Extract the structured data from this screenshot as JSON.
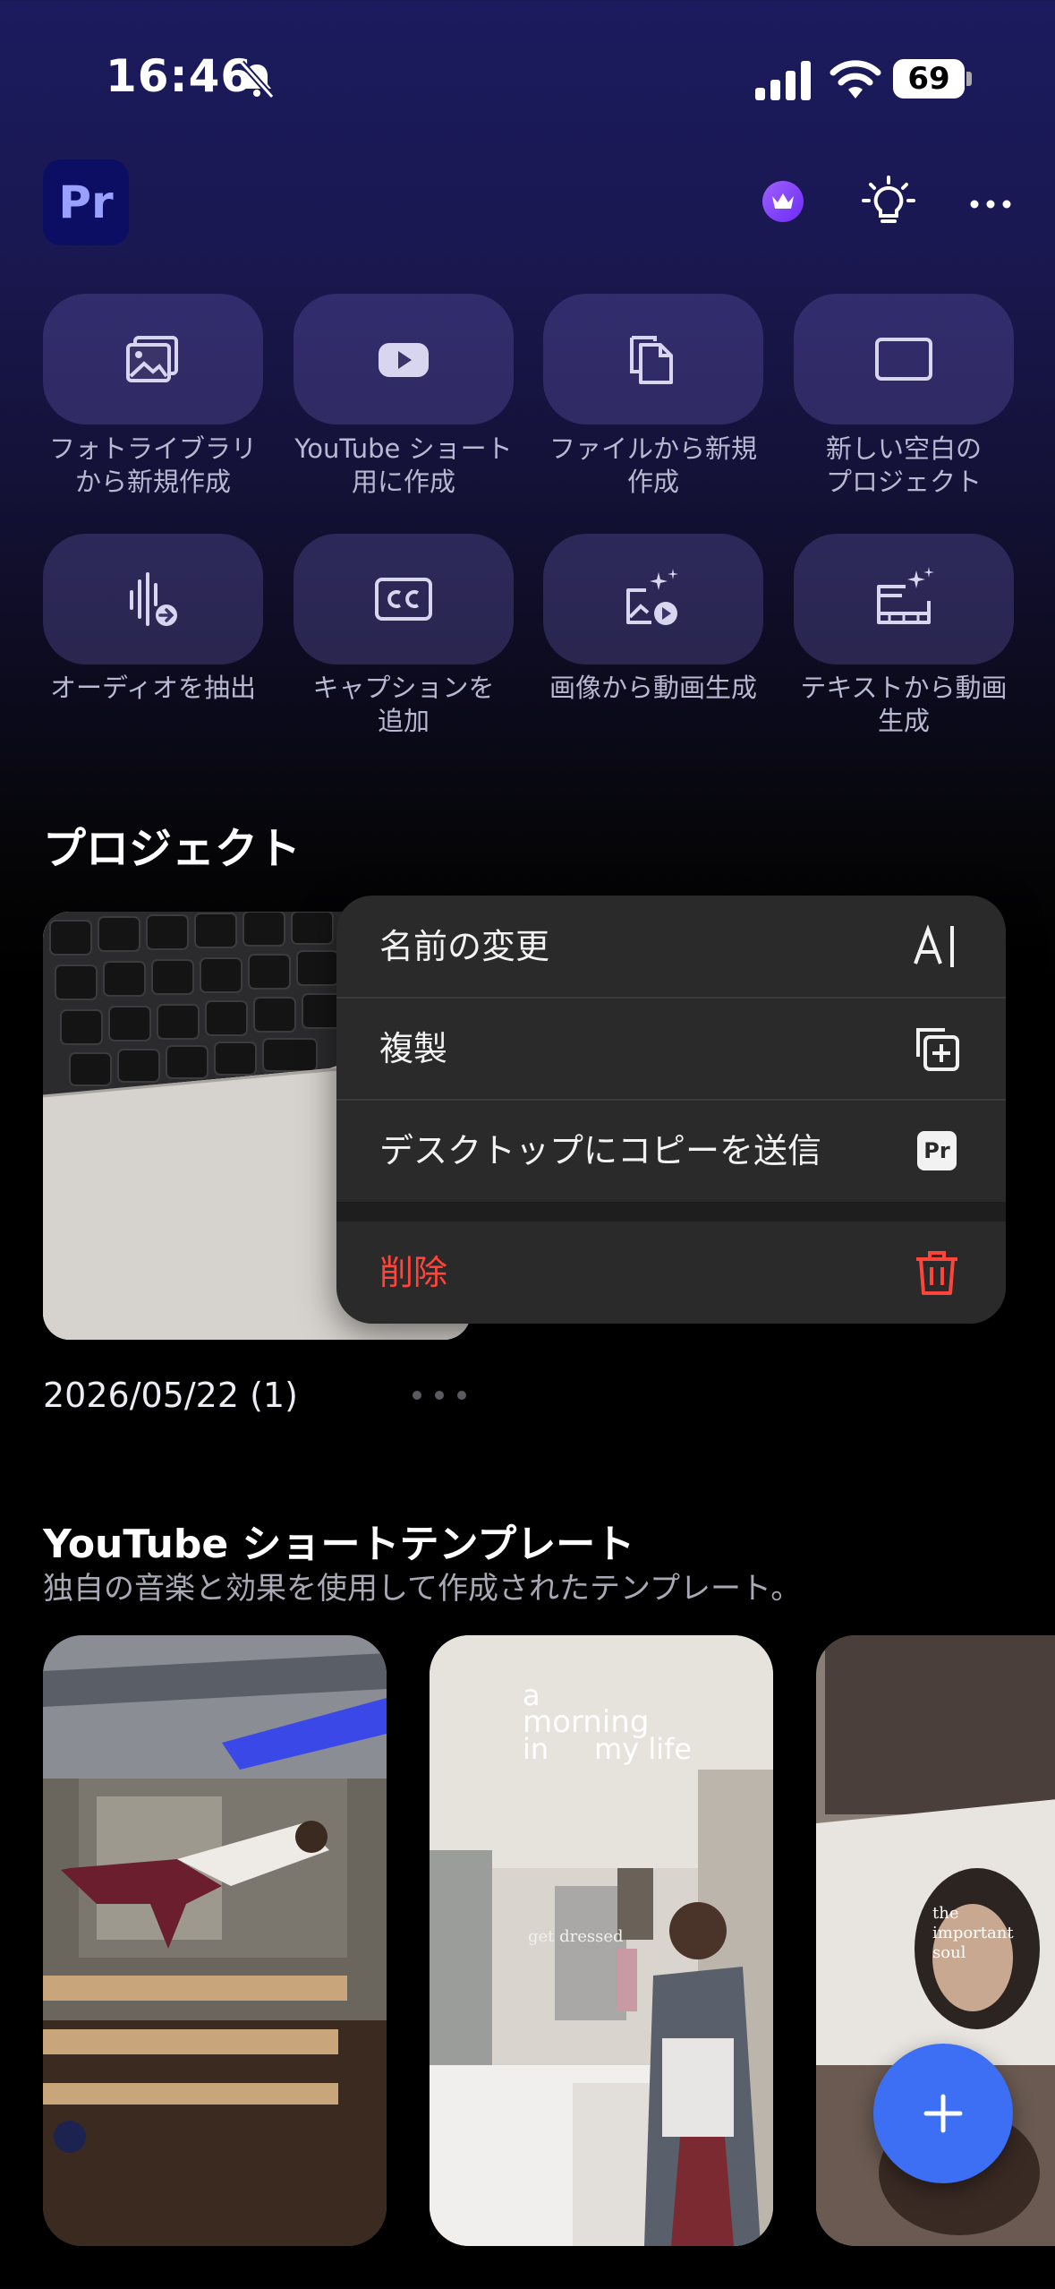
{
  "status_bar": {
    "time": "16:46",
    "battery": "69"
  },
  "header": {
    "logo_text": "Pr"
  },
  "actions": [
    {
      "label": "フォトライブラリ\nから新規作成",
      "icon": "photo-library-icon"
    },
    {
      "label": "YouTube ショート\n用に作成",
      "icon": "youtube-icon"
    },
    {
      "label": "ファイルから新規\n作成",
      "icon": "files-icon"
    },
    {
      "label": "新しい空白の\nプロジェクト",
      "icon": "blank-project-icon"
    },
    {
      "label": "オーディオを抽出",
      "icon": "extract-audio-icon"
    },
    {
      "label": "キャプションを\n追加",
      "icon": "captions-icon"
    },
    {
      "label": "画像から動画生成",
      "icon": "image-to-video-icon"
    },
    {
      "label": "テキストから動画\n生成",
      "icon": "text-to-video-icon"
    }
  ],
  "projects": {
    "title": "プロジェクト",
    "items": [
      {
        "date": "2026/05/22 (1)"
      }
    ]
  },
  "context_menu": {
    "rename": "名前の変更",
    "duplicate": "複製",
    "send_desktop": "デスクトップにコピーを送信",
    "delete": "削除",
    "desktop_badge": "Pr"
  },
  "templates": {
    "title": "YouTube ショートテンプレート",
    "subtitle": "独自の音楽と効果を使用して作成されたテンプレート。",
    "items": [
      {
        "overlay": ""
      },
      {
        "overlay_line1": "a",
        "overlay_line2": "morning",
        "overlay_line3": "in     my life",
        "caption": "get dressed"
      },
      {
        "overlay_line1": "the",
        "overlay_line2": "important",
        "overlay_line3": "soul"
      }
    ]
  },
  "colors": {
    "accent": "#3d6ff5",
    "delete_red": "#ff453a",
    "menu_bg": "#2a2a2b",
    "tile_bg": "rgba(110,100,190,0.30)"
  }
}
